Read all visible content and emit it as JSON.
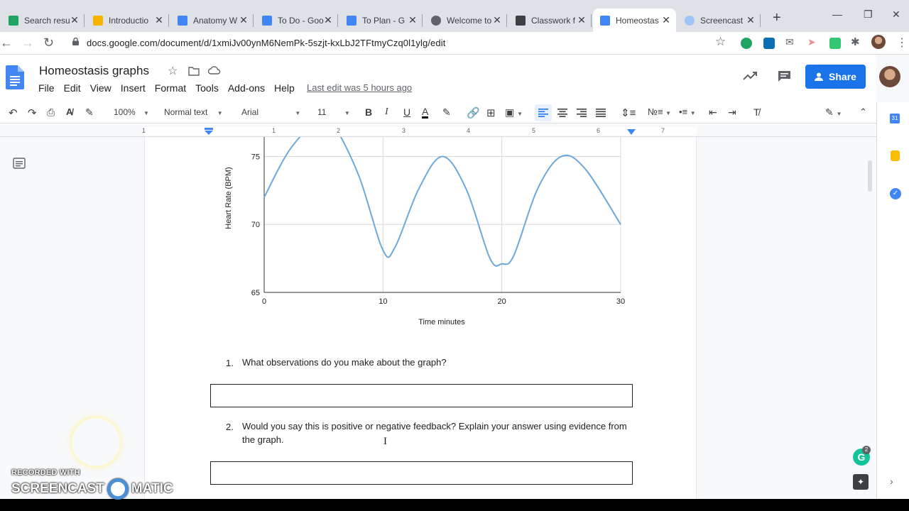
{
  "browser": {
    "tabs": [
      {
        "label": "Search resu",
        "icon": "google-drive-icon"
      },
      {
        "label": "Introductio",
        "icon": "google-slides-icon"
      },
      {
        "label": "Anatomy W",
        "icon": "google-docs-icon"
      },
      {
        "label": "To Do - Goo",
        "icon": "google-docs-icon"
      },
      {
        "label": "To Plan - G",
        "icon": "google-docs-icon"
      },
      {
        "label": "Welcome to",
        "icon": "globe-icon"
      },
      {
        "label": "Classwork f",
        "icon": "classroom-icon"
      },
      {
        "label": "Homeostas",
        "icon": "google-docs-icon",
        "active": true
      },
      {
        "label": "Screencast",
        "icon": "screencast-icon"
      }
    ],
    "url": "docs.google.com/document/d/1xmiJv00ynM6NemPk-5szjt-kxLbJ2TFtmyCzq0l1ylg/edit"
  },
  "docs": {
    "title": "Homeostasis graphs",
    "menu": [
      "File",
      "Edit",
      "View",
      "Insert",
      "Format",
      "Tools",
      "Add-ons",
      "Help"
    ],
    "last_edit": "Last edit was 5 hours ago",
    "share_label": "Share",
    "toolbar": {
      "zoom": "100%",
      "style": "Normal text",
      "font": "Arial",
      "size": "11"
    },
    "ruler_numbers": [
      "1",
      "1",
      "2",
      "3",
      "4",
      "5",
      "6",
      "7"
    ]
  },
  "chart_data": {
    "type": "line",
    "title": "",
    "xlabel": "Time minutes",
    "ylabel": "Heart Rate (BPM)",
    "xlim": [
      0,
      30
    ],
    "ylim": [
      65,
      78
    ],
    "x_ticks": [
      "0",
      "10",
      "20",
      "30"
    ],
    "y_ticks": [
      "65",
      "70",
      "75"
    ],
    "series": [
      {
        "color": "#6fa8dc",
        "x": [
          0,
          2,
          4,
          5,
          6,
          8,
          10,
          11,
          13,
          15,
          17,
          19,
          20,
          21,
          23,
          25,
          27,
          30
        ],
        "y": [
          72,
          75.3,
          77.3,
          77.5,
          77.1,
          73.5,
          68.1,
          68.3,
          72.6,
          75.0,
          72.6,
          67.5,
          67.1,
          67.7,
          72.6,
          75.0,
          74.1,
          70.0
        ]
      }
    ],
    "grid": true
  },
  "questions": [
    {
      "num": "1.",
      "text": "What observations do you make about the graph?"
    },
    {
      "num": "2.",
      "text": "Would you say this is positive or negative feedback? Explain your answer using evidence from the graph."
    }
  ],
  "watermark": {
    "top": "RECORDED WITH",
    "left": "SCREENCAST",
    "right": "MATIC"
  },
  "grammarly_count": "2"
}
